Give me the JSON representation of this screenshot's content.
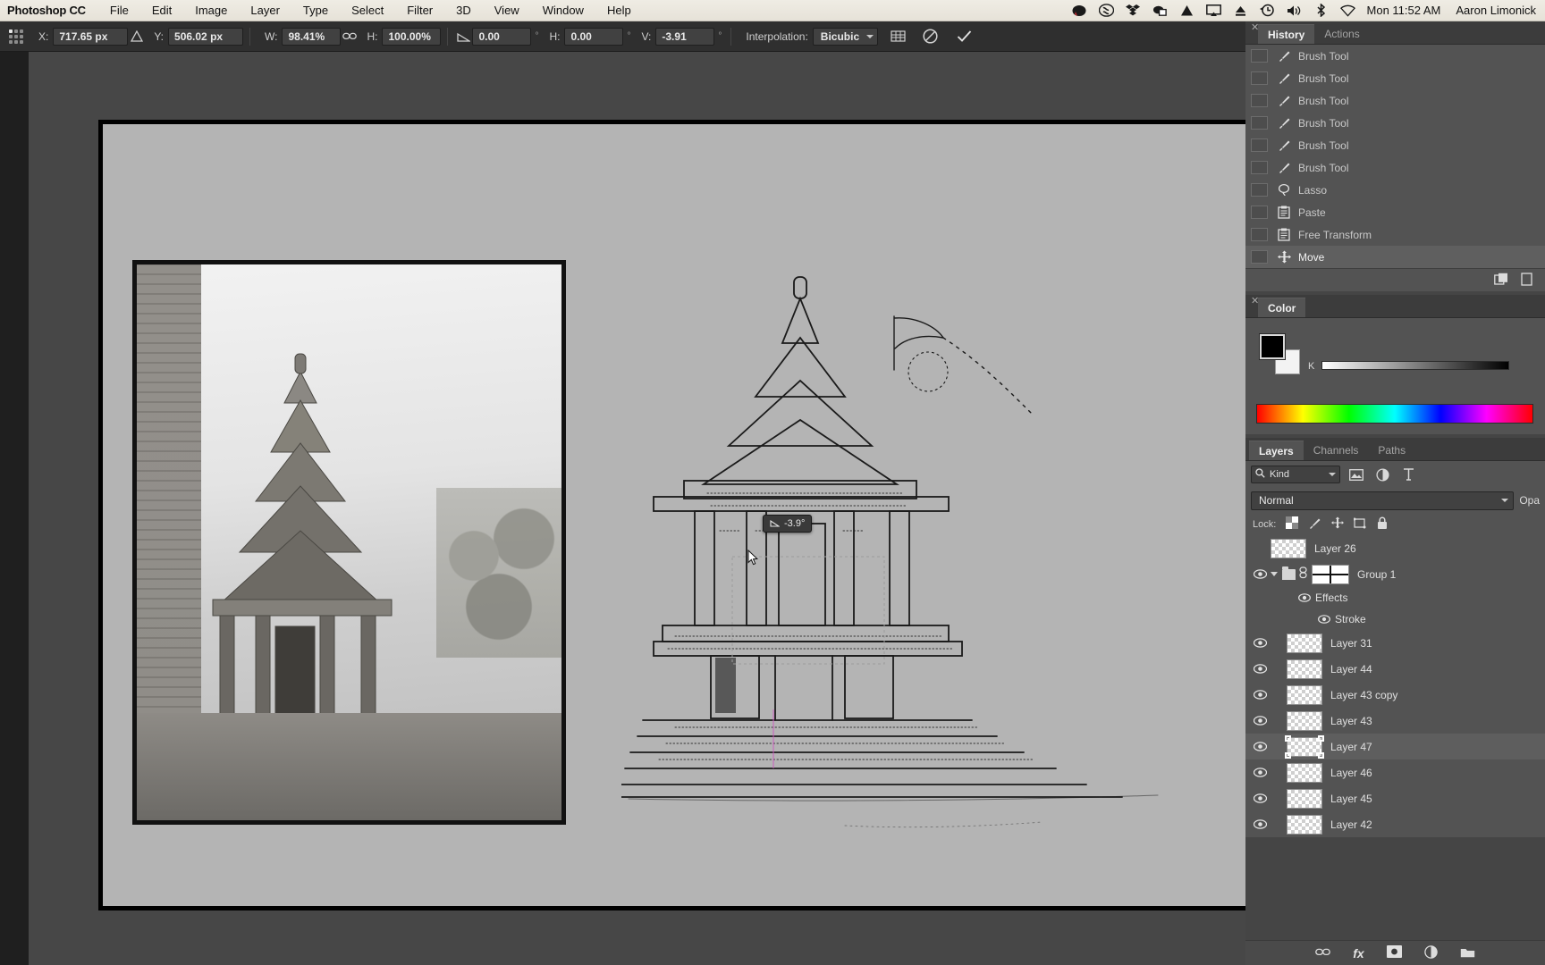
{
  "macbar": {
    "app_name": "Photoshop CC",
    "menus": [
      "File",
      "Edit",
      "Image",
      "Layer",
      "Type",
      "Select",
      "Filter",
      "3D",
      "View",
      "Window",
      "Help"
    ],
    "status_icons": [
      "adobe-cc-cloud-icon",
      "creative-cloud-icon",
      "dropbox-icon",
      "cloud-sync-icon",
      "google-drive-icon",
      "airplay-icon",
      "eject-icon",
      "time-machine-icon",
      "volume-icon",
      "bluetooth-icon",
      "wifi-icon"
    ],
    "clock": "Mon 11:52 AM",
    "user": "Aaron Limonick"
  },
  "options_bar": {
    "reference_point_label": "reference-point",
    "x_label": "X:",
    "x_value": "717.65 px",
    "y_label": "Y:",
    "y_value": "506.02 px",
    "w_label": "W:",
    "w_value": "98.41%",
    "h_label": "H:",
    "h_value": "100.00%",
    "rotate_value": "0.00",
    "skew_h_label": "H:",
    "skew_h_value": "0.00",
    "skew_v_label": "V:",
    "skew_v_value": "-3.91",
    "degree_symbol": "°",
    "interpolation_label": "Interpolation:",
    "interpolation_value": "Bicubic",
    "warp_icon": "warp-toggle-icon",
    "cancel_icon": "cancel-transform-icon",
    "commit_icon": "commit-transform-icon",
    "link_icon": "link-aspect-ratio-icon",
    "triangle_icon": "relative-position-icon",
    "skew_icon": "rotate-angle-icon"
  },
  "canvas": {
    "hud_angle_icon": "angle-icon",
    "hud_angle_value": "-3.9°",
    "cursor_icon": "move-cursor-icon",
    "document_background": "#b4b4b4"
  },
  "history_panel": {
    "tabs": [
      {
        "label": "History",
        "active": true
      },
      {
        "label": "Actions",
        "active": false
      }
    ],
    "close_icon": "close-panel-icon",
    "items": [
      {
        "label": "Brush Tool",
        "icon": "brush-icon",
        "selected": false
      },
      {
        "label": "Brush Tool",
        "icon": "brush-icon",
        "selected": false
      },
      {
        "label": "Brush Tool",
        "icon": "brush-icon",
        "selected": false
      },
      {
        "label": "Brush Tool",
        "icon": "brush-icon",
        "selected": false
      },
      {
        "label": "Brush Tool",
        "icon": "brush-icon",
        "selected": false
      },
      {
        "label": "Brush Tool",
        "icon": "brush-icon",
        "selected": false
      },
      {
        "label": "Lasso",
        "icon": "lasso-icon",
        "selected": false
      },
      {
        "label": "Paste",
        "icon": "paste-icon",
        "selected": false
      },
      {
        "label": "Free Transform",
        "icon": "paste-icon",
        "selected": false
      },
      {
        "label": "Move",
        "icon": "move-icon",
        "selected": true
      }
    ],
    "footer_icons": [
      "new-snapshot-icon",
      "new-document-icon",
      "delete-icon"
    ]
  },
  "color_panel": {
    "tabs": [
      {
        "label": "Color",
        "active": true
      }
    ],
    "close_icon": "close-panel-icon",
    "foreground_color": "#000000",
    "background_color": "#f3f3f3",
    "channel_label": "K",
    "spectrum_icon": "color-spectrum-ramp"
  },
  "layers_panel": {
    "tabs": [
      {
        "label": "Layers",
        "active": true
      },
      {
        "label": "Channels",
        "active": false
      },
      {
        "label": "Paths",
        "active": false
      }
    ],
    "filter_kind_label": "Kind",
    "filter_search_icon": "search-icon",
    "filter_icons": [
      "pixel-filter-icon",
      "adjustment-filter-icon",
      "type-filter-icon"
    ],
    "blend_mode": "Normal",
    "opacity_label": "Opa",
    "lock_label": "Lock:",
    "lock_icons": [
      "lock-transparent-pixels-icon",
      "lock-image-pixels-icon",
      "lock-position-icon",
      "lock-artboard-icon",
      "lock-all-icon"
    ],
    "layers": [
      {
        "name": "Layer 26",
        "visible": false,
        "selected": false,
        "type": "pixel",
        "indent": 0
      },
      {
        "name": "Group 1",
        "visible": true,
        "selected": false,
        "type": "group",
        "indent": 0
      },
      {
        "name": "Effects",
        "visible": true,
        "selected": false,
        "type": "effects",
        "indent": 1
      },
      {
        "name": "Stroke",
        "visible": true,
        "selected": false,
        "type": "effect",
        "indent": 2
      },
      {
        "name": "Layer 31",
        "visible": true,
        "selected": false,
        "type": "pixel",
        "indent": 0
      },
      {
        "name": "Layer 44",
        "visible": true,
        "selected": false,
        "type": "pixel",
        "indent": 0
      },
      {
        "name": "Layer 43 copy",
        "visible": true,
        "selected": false,
        "type": "pixel",
        "indent": 0
      },
      {
        "name": "Layer 43",
        "visible": true,
        "selected": false,
        "type": "pixel",
        "indent": 0
      },
      {
        "name": "Layer 47",
        "visible": true,
        "selected": true,
        "type": "pixel",
        "indent": 0
      },
      {
        "name": "Layer 46",
        "visible": true,
        "selected": false,
        "type": "pixel",
        "indent": 0
      },
      {
        "name": "Layer 45",
        "visible": true,
        "selected": false,
        "type": "pixel",
        "indent": 0
      },
      {
        "name": "Layer 42",
        "visible": true,
        "selected": false,
        "type": "pixel",
        "indent": 0
      }
    ],
    "footer_icons": [
      "link-layers-icon",
      "fx-icon",
      "add-mask-icon",
      "adjustment-layer-icon",
      "new-group-icon",
      "new-layer-icon",
      "delete-layer-icon"
    ],
    "fx_label": "fx"
  }
}
